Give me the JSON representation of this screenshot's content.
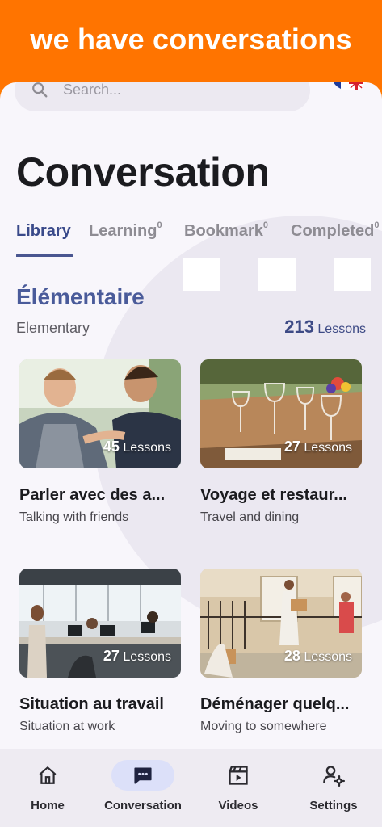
{
  "banner": {
    "text": "we have conversations"
  },
  "search": {
    "placeholder": "Search..."
  },
  "header": {
    "title": "Conversation"
  },
  "tabs": [
    {
      "label": "Library",
      "count": "",
      "active": true
    },
    {
      "label": "Learning",
      "count": "0",
      "active": false
    },
    {
      "label": "Bookmark",
      "count": "0",
      "active": false
    },
    {
      "label": "Completed",
      "count": "0",
      "active": false
    }
  ],
  "section": {
    "level_title": "Élémentaire",
    "level_subtitle": "Elementary",
    "lesson_count": "213",
    "lesson_label": "Lessons"
  },
  "cards": [
    {
      "title": "Parler avec des a...",
      "subtitle": "Talking with friends",
      "lessons": "45",
      "lessons_label": "Lessons",
      "icon": "friends-photo"
    },
    {
      "title": "Voyage et restaur...",
      "subtitle": "Travel and dining",
      "lessons": "27",
      "lessons_label": "Lessons",
      "icon": "dining-photo"
    },
    {
      "title": "Situation au travail",
      "subtitle": "Situation at work",
      "lessons": "27",
      "lessons_label": "Lessons",
      "icon": "office-photo"
    },
    {
      "title": "Déménager quelq...",
      "subtitle": "Moving to somewhere",
      "lessons": "28",
      "lessons_label": "Lessons",
      "icon": "moving-photo"
    }
  ],
  "nav": [
    {
      "label": "Home",
      "icon": "home-icon",
      "active": false
    },
    {
      "label": "Conversation",
      "icon": "chat-icon",
      "active": true
    },
    {
      "label": "Videos",
      "icon": "video-icon",
      "active": false
    },
    {
      "label": "Settings",
      "icon": "settings-icon",
      "active": false
    }
  ],
  "colors": {
    "banner": "#ff7400",
    "accent": "#4a5690",
    "nav_active": "#dce0f9"
  }
}
